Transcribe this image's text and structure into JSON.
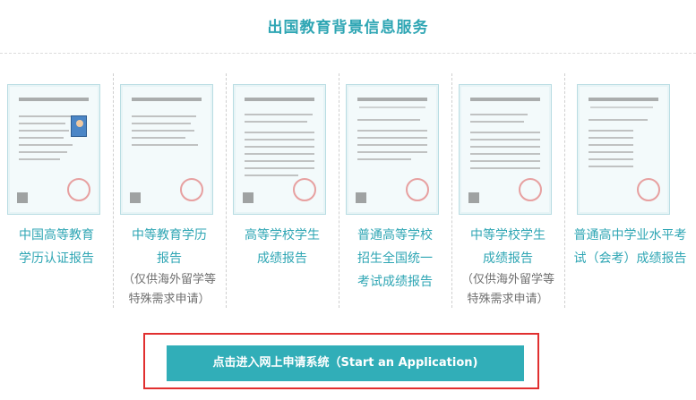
{
  "heading": "出国教育背景信息服务",
  "cards": [
    {
      "label": "中国高等教育\n学历认证报告",
      "note": ""
    },
    {
      "label": "中等教育学历\n报告",
      "note": "（仅供海外留学等\n特殊需求申请）"
    },
    {
      "label": "高等学校学生\n成绩报告",
      "note": ""
    },
    {
      "label": "普通高等学校\n招生全国统一\n考试成绩报告",
      "note": ""
    },
    {
      "label": "中等学校学生\n成绩报告",
      "note": "（仅供海外留学等\n特殊需求申请）"
    },
    {
      "label": "普通高中学业水平考\n试（会考）成绩报告",
      "note": ""
    }
  ],
  "apply_button": "点击进入网上申请系统（Start an Application)",
  "colors": {
    "accent": "#2fa6b4",
    "button": "#31aeb8",
    "highlight": "#e12f2f"
  }
}
